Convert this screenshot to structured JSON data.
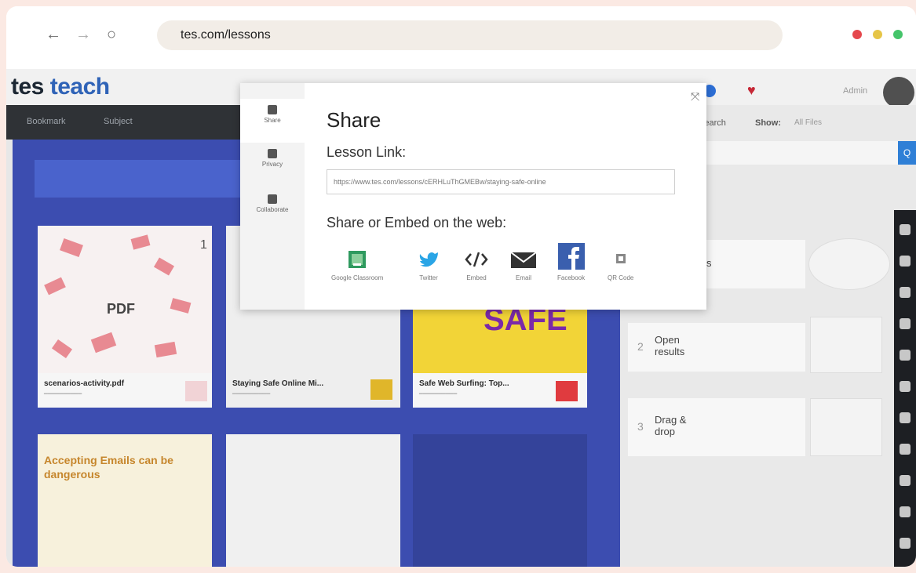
{
  "browser": {
    "url": "tes.com/lessons",
    "nav": {
      "back": "←",
      "forward": "→",
      "reload": "○"
    },
    "dots": [
      "#e5484d",
      "#e6c547",
      "#45c46a"
    ]
  },
  "app": {
    "logo_part1": "tes",
    "logo_part2": "teach",
    "admin_label": "Admin",
    "topnav": [
      "Bookmark",
      "Subject"
    ],
    "search_label": "Search",
    "show_label": "Show:",
    "show_value": "All Files",
    "search_button": "Q"
  },
  "board": {
    "cards": [
      {
        "title": "scenarios-activity.pdf",
        "badge": "PDF",
        "number": "1",
        "tag_color": "#d6384d"
      },
      {
        "title": "Staying Safe Online Mi...",
        "tag_color": "#e0b62a"
      },
      {
        "title": "Safe Web Surfing: Top...",
        "thumb_text": "SAFE",
        "tag_color": "#e03b3f"
      },
      {
        "title": "Accepting Emails can be dangerous"
      }
    ]
  },
  "steps": [
    {
      "num": "2",
      "label": "Open results"
    },
    {
      "num": "3",
      "label": "Drag & drop"
    }
  ],
  "step_partial": "s",
  "modal": {
    "tabs": [
      {
        "label": "Share",
        "icon": "share-icon"
      },
      {
        "label": "Privacy",
        "icon": "lock-icon"
      },
      {
        "label": "Collaborate",
        "icon": "people-icon"
      }
    ],
    "title": "Share",
    "lesson_link_label": "Lesson Link:",
    "lesson_link_value": "https://www.tes.com/lessons/cERHLuThGMEBw/staying-safe-online",
    "embed_label": "Share or Embed on the web:",
    "share_options": [
      {
        "label": "Google Classroom",
        "icon": "google-classroom-icon",
        "color": "#2f9a5f"
      },
      {
        "label": "Twitter",
        "icon": "twitter-icon",
        "color": "#2aa5e6"
      },
      {
        "label": "Embed",
        "icon": "embed-icon",
        "color": "#444444"
      },
      {
        "label": "Email",
        "icon": "email-icon",
        "color": "#444444"
      },
      {
        "label": "Facebook",
        "icon": "facebook-icon",
        "color": "#3a5fae"
      },
      {
        "label": "QR Code",
        "icon": "qr-code-icon",
        "color": "#888888"
      }
    ],
    "close_symbol": "⤧"
  }
}
